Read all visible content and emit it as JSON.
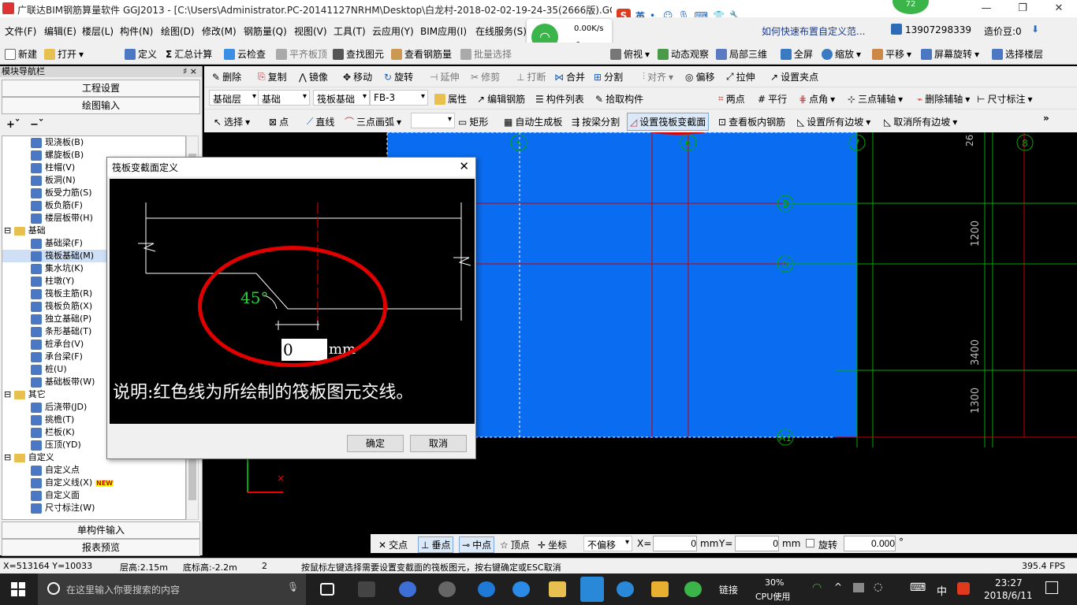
{
  "window": {
    "title": "广联达BIM钢筋算量软件 GGJ2013 - [C:\\Users\\Administrator.PC-20141127NRHM\\Desktop\\白龙村-2018-02-02-19-24-35(2666版).GGJ12]",
    "hint_link": "如何快速布置自定义范...",
    "phone": "13907298339",
    "price_label": "造价豆:0",
    "badge_count": "72"
  },
  "net_widget": {
    "speed": "0.00K/s",
    "count": "0"
  },
  "ime_label": "英",
  "menu": [
    "文件(F)",
    "编辑(E)",
    "楼层(L)",
    "构件(N)",
    "绘图(D)",
    "修改(M)",
    "钢筋量(Q)",
    "视图(V)",
    "工具(T)",
    "云应用(Y)",
    "BIM应用(I)",
    "在线服务(S)"
  ],
  "toolbar1": [
    "新建",
    "打开",
    "定义",
    "汇总计算",
    "云检查",
    "平齐板顶",
    "查找图元",
    "查看钢筋量",
    "批量选择",
    "俯视",
    "动态观察",
    "局部三维",
    "全屏",
    "缩放",
    "平移",
    "屏幕旋转",
    "选择楼层"
  ],
  "toolbar2": [
    "删除",
    "复制",
    "镜像",
    "移动",
    "旋转",
    "延伸",
    "修剪",
    "打断",
    "合并",
    "分割",
    "对齐",
    "偏移",
    "拉伸",
    "设置夹点"
  ],
  "toolbar3": {
    "combos": [
      "基础层",
      "基础",
      "筏板基础",
      "FB-3"
    ],
    "items": [
      "属性",
      "编辑钢筋",
      "构件列表",
      "拾取构件",
      "两点",
      "平行",
      "点角",
      "三点辅轴",
      "删除辅轴",
      "尺寸标注"
    ]
  },
  "toolbar4": [
    "选择",
    "点",
    "直线",
    "三点画弧",
    "矩形",
    "自动生成板",
    "按梁分割",
    "设置筏板变截面",
    "查看板内钢筋",
    "设置所有边坡",
    "取消所有边坡"
  ],
  "nav": {
    "header": "模块导航栏",
    "pin": "♯ ×",
    "buttons_top": [
      "工程设置",
      "绘图输入"
    ],
    "buttons_bottom": [
      "单构件输入",
      "报表预览"
    ],
    "tree": [
      {
        "label": "现浇板(B)",
        "level": 2,
        "type": "item"
      },
      {
        "label": "螺旋板(B)",
        "level": 2,
        "type": "item"
      },
      {
        "label": "柱帽(V)",
        "level": 2,
        "type": "item"
      },
      {
        "label": "板洞(N)",
        "level": 2,
        "type": "item"
      },
      {
        "label": "板受力筋(S)",
        "level": 2,
        "type": "item"
      },
      {
        "label": "板负筋(F)",
        "level": 2,
        "type": "item"
      },
      {
        "label": "楼层板带(H)",
        "level": 2,
        "type": "item"
      },
      {
        "label": "基础",
        "level": 1,
        "type": "folder"
      },
      {
        "label": "基础梁(F)",
        "level": 2,
        "type": "item"
      },
      {
        "label": "筏板基础(M)",
        "level": 2,
        "type": "item",
        "selected": true
      },
      {
        "label": "集水坑(K)",
        "level": 2,
        "type": "item"
      },
      {
        "label": "柱墩(Y)",
        "level": 2,
        "type": "item"
      },
      {
        "label": "筏板主筋(R)",
        "level": 2,
        "type": "item"
      },
      {
        "label": "筏板负筋(X)",
        "level": 2,
        "type": "item"
      },
      {
        "label": "独立基础(P)",
        "level": 2,
        "type": "item"
      },
      {
        "label": "条形基础(T)",
        "level": 2,
        "type": "item"
      },
      {
        "label": "桩承台(V)",
        "level": 2,
        "type": "item"
      },
      {
        "label": "承台梁(F)",
        "level": 2,
        "type": "item"
      },
      {
        "label": "桩(U)",
        "level": 2,
        "type": "item"
      },
      {
        "label": "基础板带(W)",
        "level": 2,
        "type": "item"
      },
      {
        "label": "其它",
        "level": 1,
        "type": "folder"
      },
      {
        "label": "后浇带(JD)",
        "level": 2,
        "type": "item"
      },
      {
        "label": "挑檐(T)",
        "level": 2,
        "type": "item"
      },
      {
        "label": "栏板(K)",
        "level": 2,
        "type": "item"
      },
      {
        "label": "压顶(YD)",
        "level": 2,
        "type": "item"
      },
      {
        "label": "自定义",
        "level": 1,
        "type": "folder"
      },
      {
        "label": "自定义点",
        "level": 2,
        "type": "item"
      },
      {
        "label": "自定义线(X)",
        "level": 2,
        "type": "item",
        "new": true
      },
      {
        "label": "自定义面",
        "level": 2,
        "type": "item"
      },
      {
        "label": "尺寸标注(W)",
        "level": 2,
        "type": "item"
      }
    ],
    "new_badge": "NEW"
  },
  "dialog": {
    "title": "筏板变截面定义",
    "angle": "45°",
    "value": "0",
    "unit": "mm",
    "note": "说明:红色线为所绘制的筏板图元交线。",
    "ok": "确定",
    "cancel": "取消"
  },
  "canvas": {
    "axis_labels_top": [
      "5",
      "6",
      "7",
      "8"
    ],
    "axis_labels_left": [
      "B",
      "0",
      "A1"
    ],
    "dims": [
      "26",
      "1200",
      "3400",
      "1300"
    ]
  },
  "bottombar": {
    "items": [
      "交点",
      "垂点",
      "中点",
      "顶点",
      "坐标"
    ],
    "offset_mode": "不偏移",
    "x_label": "X=",
    "x_value": "0",
    "y_label": "Y=",
    "y_value": "0",
    "unit": "mm",
    "rotate_label": "旋转",
    "rotate_value": "0.000",
    "degree": "°"
  },
  "statusbar": {
    "coords": "X=513164 Y=10033",
    "floor_height": "层高:2.15m",
    "bottom_height": "底标高:-2.2m",
    "num": "2",
    "hint": "按鼠标左键选择需要设置变截面的筏板图元，按右键确定或ESC取消",
    "fps": "395.4 FPS"
  },
  "taskbar": {
    "search_placeholder": "在这里输入你要搜索的内容",
    "link": "链接",
    "cpu_pct": "30%",
    "cpu_label": "CPU使用",
    "lang": "中",
    "time": "23:27",
    "date": "2018/6/11"
  }
}
